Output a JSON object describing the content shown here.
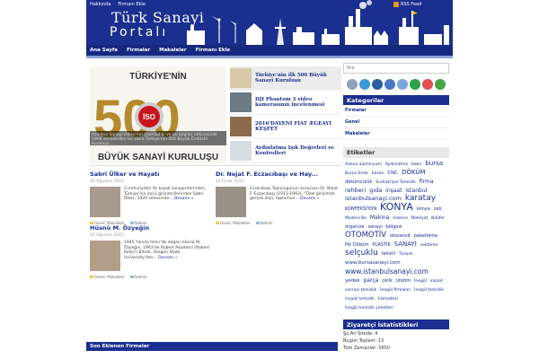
{
  "header": {
    "top_links": [
      "Hakkında",
      "Firmanı Ekle"
    ],
    "logo_line1": "Türk Sanayi",
    "logo_line2": "Portalı",
    "rss_label": "RSS Feed",
    "colors": {
      "primary": "#1a2f8f",
      "accent": "#f7941d"
    }
  },
  "nav": {
    "items": [
      "Ana Sayfa",
      "Firmalar",
      "Makaleler",
      "Firmanı Ekle"
    ]
  },
  "slider": {
    "image_title": "TÜRKİYE'NİN",
    "image_number": "500",
    "image_subtitle": "BÜYÜK SANAYİ KURULUŞU",
    "image_badge": "İSO",
    "caption": "İstanbul Sanayi Odası'nın hazırladığı ve bu bilgiler neticesinde 1968 senesinden bu yana Türkiye'nin 500 Büyük Endüstri Kuruluşu ..."
  },
  "thumbs": [
    {
      "title": "Türkiye'nin ilk 500 Büyük Sanayi Kuruluşu",
      "active": true
    },
    {
      "title": "DJI Phantom 3 video kamerasının incelenmesi",
      "active": false
    },
    {
      "title": "2016'DAYENİ FIAT ÆGEAYI KEŞFET",
      "active": false
    },
    {
      "title": "Aydınlatma Işık Değerleri ve Kontrolleri",
      "active": false
    }
  ],
  "posts": [
    {
      "title": "Sabri Ülker ve Hayatı",
      "date": "16 Ağustos 2015",
      "excerpt": "Cumhuriyetin ilk kuşak sanayicilerinden, Türkiye'nin öncü girişimcilerinden Sabri Ülker, 1920 senesinde...",
      "more": "Devamı »",
      "cats": "Genel, Makaleler",
      "author": "fadmin"
    },
    {
      "title": "Dr. Nejat F. Eczacıbaşı ve Hay...",
      "date": "14 Ocak 2015",
      "excerpt": "Eczacıbaşı Topluluğunun kurucusu Dr. Nejat F. Eczacıbaşı (1913-1993), \"Özel girişimde gerçek ölçü, toplumun...",
      "more": "Devamı »",
      "cats": "Genel, Makaleler",
      "author": "fadmin"
    },
    {
      "title": "Hüsnü M. Özyeğin",
      "date": "16 Ağustos 2015",
      "excerpt": "1945 Yılında İzmir'de doğan Hüsnü M. Özyeğin, 1963'de Robert Akademi (Robert Kolej'i) Bitirdi, Oregon State University'den...",
      "more": "Devamı »",
      "cats": "Genel, Makaleler",
      "author": "fadmin"
    }
  ],
  "recent_title": "Son Eklenen Firmalar",
  "sidebar": {
    "search_placeholder": "Ara",
    "social_colors": [
      "#8ea2b8",
      "#3b9bd6",
      "#2a5ea8",
      "#4d77c2",
      "#7aa8d8",
      "#2aa34a",
      "#e05050",
      "#44a844"
    ],
    "categories_title": "Kategoriler",
    "categories": [
      "Firmalar",
      "Genel",
      "Makaleler"
    ],
    "tags_title": "Etiketler",
    "tags": [
      {
        "t": "Adana alüminyum",
        "s": 4.5
      },
      {
        "t": "Aydınlatma",
        "s": 4.5
      },
      {
        "t": "bakır",
        "s": 4.5
      },
      {
        "t": "bursa",
        "s": 7
      },
      {
        "t": "Bursa tinde",
        "s": 4.5
      },
      {
        "t": "büsan",
        "s": 4.5
      },
      {
        "t": "CNC",
        "s": 5.5
      },
      {
        "t": "DÖKÜM",
        "s": 7
      },
      {
        "t": "dökümcülük",
        "s": 5
      },
      {
        "t": "Endüstriyel Temizlik",
        "s": 4.5
      },
      {
        "t": "firma",
        "s": 6
      },
      {
        "t": "rehberi",
        "s": 6.5
      },
      {
        "t": "gıda",
        "s": 6.5
      },
      {
        "t": "inşaat",
        "s": 6
      },
      {
        "t": "istanbul",
        "s": 6
      },
      {
        "t": "istanbulsanayi.com",
        "s": 6.5
      },
      {
        "t": "karatay",
        "s": 9
      },
      {
        "t": "KONFEKSİYON",
        "s": 5
      },
      {
        "t": "KONYA",
        "s": 11
      },
      {
        "t": "konya",
        "s": 5
      },
      {
        "t": "osb",
        "s": 5
      },
      {
        "t": "Madencilik",
        "s": 4.5
      },
      {
        "t": "Makina",
        "s": 6
      },
      {
        "t": "makine",
        "s": 4.5
      },
      {
        "t": "Nakliyat",
        "s": 4.5
      },
      {
        "t": "Nilüfer",
        "s": 4.5
      },
      {
        "t": "organize",
        "s": 5
      },
      {
        "t": "sanayi",
        "s": 5
      },
      {
        "t": "bölgesi",
        "s": 5
      },
      {
        "t": "OTOMOTİV",
        "s": 8.5
      },
      {
        "t": "otosansit",
        "s": 5
      },
      {
        "t": "paketleme",
        "s": 5
      },
      {
        "t": "Pik Döküm",
        "s": 5
      },
      {
        "t": "PLASTİK",
        "s": 5
      },
      {
        "t": "SANAYİ",
        "s": 7
      },
      {
        "t": "sektörler",
        "s": 4.5
      },
      {
        "t": "selçuklu",
        "s": 9
      },
      {
        "t": "tekstil",
        "s": 5
      },
      {
        "t": "Ticaret",
        "s": 4.5
      },
      {
        "t": "www.bursasanayi.com",
        "s": 5.5
      },
      {
        "t": "www.istanbulsanayi.com",
        "s": 7.5
      },
      {
        "t": "yedek",
        "s": 5.5
      },
      {
        "t": "parça",
        "s": 6
      },
      {
        "t": "çelik",
        "s": 5
      },
      {
        "t": "üretim",
        "s": 5
      },
      {
        "t": "İnegöl",
        "s": 4.5
      },
      {
        "t": "inşaat",
        "s": 4.5
      },
      {
        "t": "sonrası temizlik",
        "s": 4.5
      },
      {
        "t": "İnegöl firmaları",
        "s": 4.5
      },
      {
        "t": "İnegöl temizlik",
        "s": 4.5
      },
      {
        "t": "inşaat temizlik",
        "s": 4.5
      },
      {
        "t": "hizmetleri",
        "s": 4.5
      },
      {
        "t": "İnegöl temizlik şirketleri",
        "s": 4.5
      }
    ],
    "stats_title": "Ziyaretçi İstatistikleri",
    "stats": [
      "Şu An Sitede: 4",
      "Bugün Toplam: 13",
      "Tüm Zamanlar: 5650"
    ]
  }
}
